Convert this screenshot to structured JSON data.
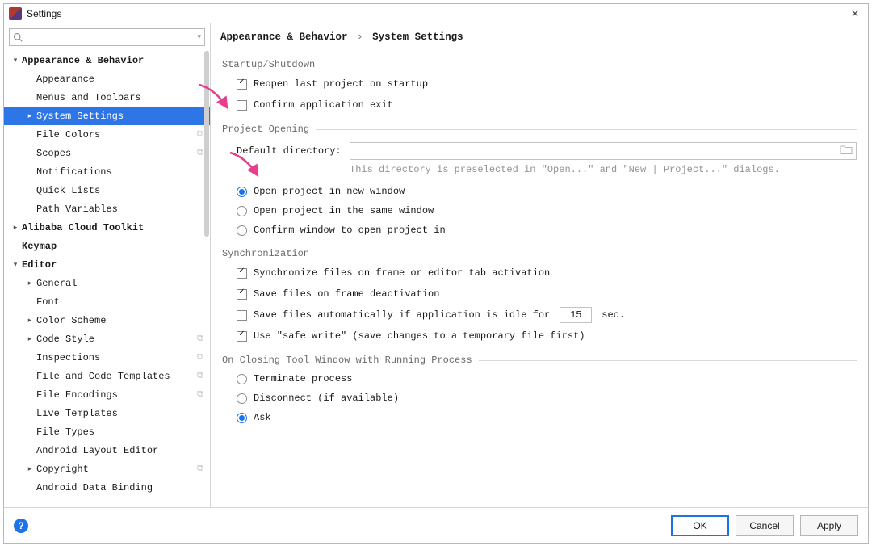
{
  "window": {
    "title": "Settings",
    "close_icon": "✕"
  },
  "search": {
    "placeholder": ""
  },
  "tree": [
    {
      "label": "Appearance & Behavior",
      "depth": 0,
      "caret": "down",
      "bold": true
    },
    {
      "label": "Appearance",
      "depth": 1
    },
    {
      "label": "Menus and Toolbars",
      "depth": 1
    },
    {
      "label": "System Settings",
      "depth": 1,
      "caret": "right",
      "selected": true
    },
    {
      "label": "File Colors",
      "depth": 1,
      "trailing": "⧉"
    },
    {
      "label": "Scopes",
      "depth": 1,
      "trailing": "⧉"
    },
    {
      "label": "Notifications",
      "depth": 1
    },
    {
      "label": "Quick Lists",
      "depth": 1
    },
    {
      "label": "Path Variables",
      "depth": 1
    },
    {
      "label": "Alibaba Cloud Toolkit",
      "depth": 0,
      "caret": "right",
      "bold": true
    },
    {
      "label": "Keymap",
      "depth": 0,
      "bold": true
    },
    {
      "label": "Editor",
      "depth": 0,
      "caret": "down",
      "bold": true
    },
    {
      "label": "General",
      "depth": 1,
      "caret": "right"
    },
    {
      "label": "Font",
      "depth": 1
    },
    {
      "label": "Color Scheme",
      "depth": 1,
      "caret": "right"
    },
    {
      "label": "Code Style",
      "depth": 1,
      "caret": "right",
      "trailing": "⧉"
    },
    {
      "label": "Inspections",
      "depth": 1,
      "trailing": "⧉"
    },
    {
      "label": "File and Code Templates",
      "depth": 1,
      "trailing": "⧉"
    },
    {
      "label": "File Encodings",
      "depth": 1,
      "trailing": "⧉"
    },
    {
      "label": "Live Templates",
      "depth": 1
    },
    {
      "label": "File Types",
      "depth": 1
    },
    {
      "label": "Android Layout Editor",
      "depth": 1
    },
    {
      "label": "Copyright",
      "depth": 1,
      "caret": "right",
      "trailing": "⧉"
    },
    {
      "label": "Android Data Binding",
      "depth": 1
    }
  ],
  "breadcrumb": {
    "part0": "Appearance & Behavior",
    "sep": "›",
    "part1": "System Settings"
  },
  "groups": {
    "startup": {
      "title": "Startup/Shutdown",
      "reopen": {
        "label": "Reopen last project on startup",
        "checked": true
      },
      "confirm_exit": {
        "label": "Confirm application exit",
        "checked": false
      }
    },
    "project_opening": {
      "title": "Project Opening",
      "default_dir_label": "Default directory:",
      "default_dir_value": "",
      "hint": "This directory is preselected in \"Open...\" and \"New | Project...\" dialogs.",
      "radio": {
        "new_window": "Open project in new window",
        "same_window": "Open project in the same window",
        "confirm": "Confirm window to open project in",
        "selected": "new_window"
      }
    },
    "sync": {
      "title": "Synchronization",
      "on_activation": {
        "label": "Synchronize files on frame or editor tab activation",
        "checked": true
      },
      "on_deactivation": {
        "label": "Save files on frame deactivation",
        "checked": true
      },
      "idle": {
        "label_before": "Save files automatically if application is idle for",
        "value": "15",
        "label_after": "sec.",
        "checked": false
      },
      "safe_write": {
        "label": "Use \"safe write\" (save changes to a temporary file first)",
        "checked": true
      }
    },
    "closing": {
      "title": "On Closing Tool Window with Running Process",
      "radio": {
        "terminate": "Terminate process",
        "disconnect": "Disconnect (if available)",
        "ask": "Ask",
        "selected": "ask"
      }
    }
  },
  "buttons": {
    "ok": "OK",
    "cancel": "Cancel",
    "apply": "Apply",
    "help": "?"
  }
}
